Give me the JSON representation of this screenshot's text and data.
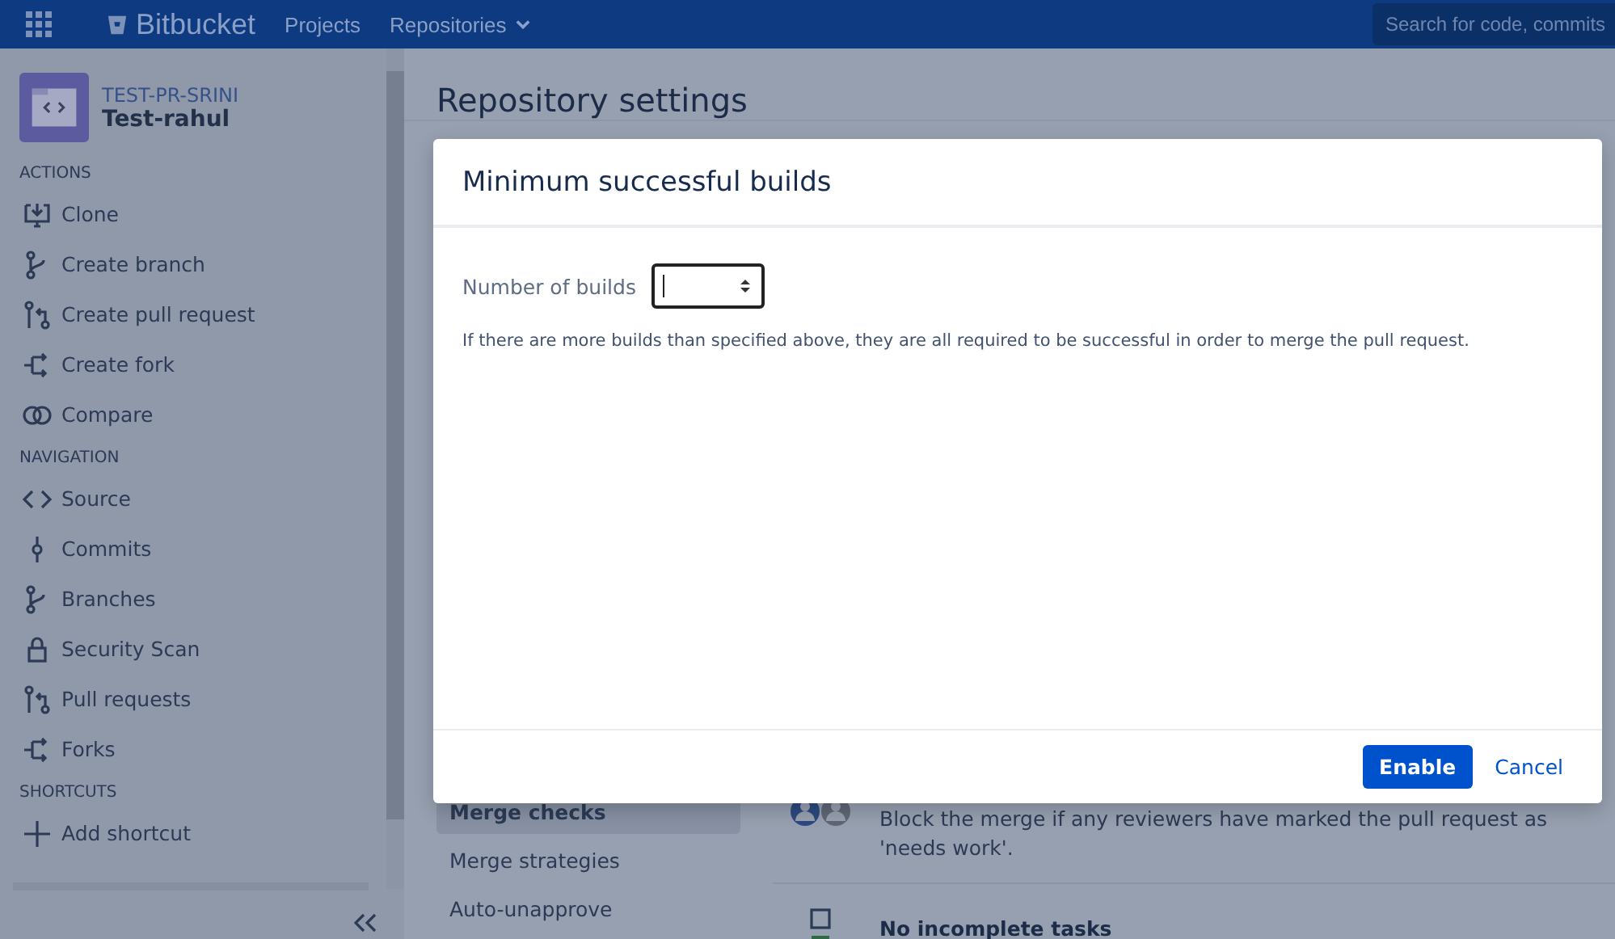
{
  "topbar": {
    "product": "Bitbucket",
    "links": [
      {
        "label": "Projects",
        "dropdown": false
      },
      {
        "label": "Repositories",
        "dropdown": true
      }
    ],
    "search": {
      "placeholder": "Search for code, commits"
    }
  },
  "repo": {
    "project": "TEST-PR-SRINI",
    "name": "Test-rahul"
  },
  "sidebar": {
    "sections": [
      {
        "title": "ACTIONS",
        "items": [
          {
            "label": "Clone"
          },
          {
            "label": "Create branch"
          },
          {
            "label": "Create pull request"
          },
          {
            "label": "Create fork"
          },
          {
            "label": "Compare"
          }
        ]
      },
      {
        "title": "NAVIGATION",
        "items": [
          {
            "label": "Source"
          },
          {
            "label": "Commits"
          },
          {
            "label": "Branches"
          },
          {
            "label": "Security Scan"
          },
          {
            "label": "Pull requests"
          },
          {
            "label": "Forks"
          }
        ]
      },
      {
        "title": "SHORTCUTS",
        "items": [
          {
            "label": "Add shortcut"
          }
        ]
      }
    ]
  },
  "page": {
    "title": "Repository settings",
    "settings_nav": [
      {
        "label": "Merge checks",
        "selected": true
      },
      {
        "label": "Merge strategies",
        "selected": false
      },
      {
        "label": "Auto-unapprove",
        "selected": false
      }
    ],
    "checks": [
      {
        "kind": "reviewers",
        "description": "Block the merge if any reviewers have marked the pull request as 'needs work'."
      },
      {
        "kind": "tasks",
        "title": "No incomplete tasks"
      }
    ]
  },
  "dialog": {
    "title": "Minimum successful builds",
    "field": {
      "label": "Number of builds"
    },
    "help": "If there are more builds than specified above, they are all required to be successful in order to merge the pull request.",
    "buttons": [
      {
        "label": "Enable",
        "kind": "primary"
      },
      {
        "label": "Cancel",
        "kind": "link"
      }
    ]
  }
}
